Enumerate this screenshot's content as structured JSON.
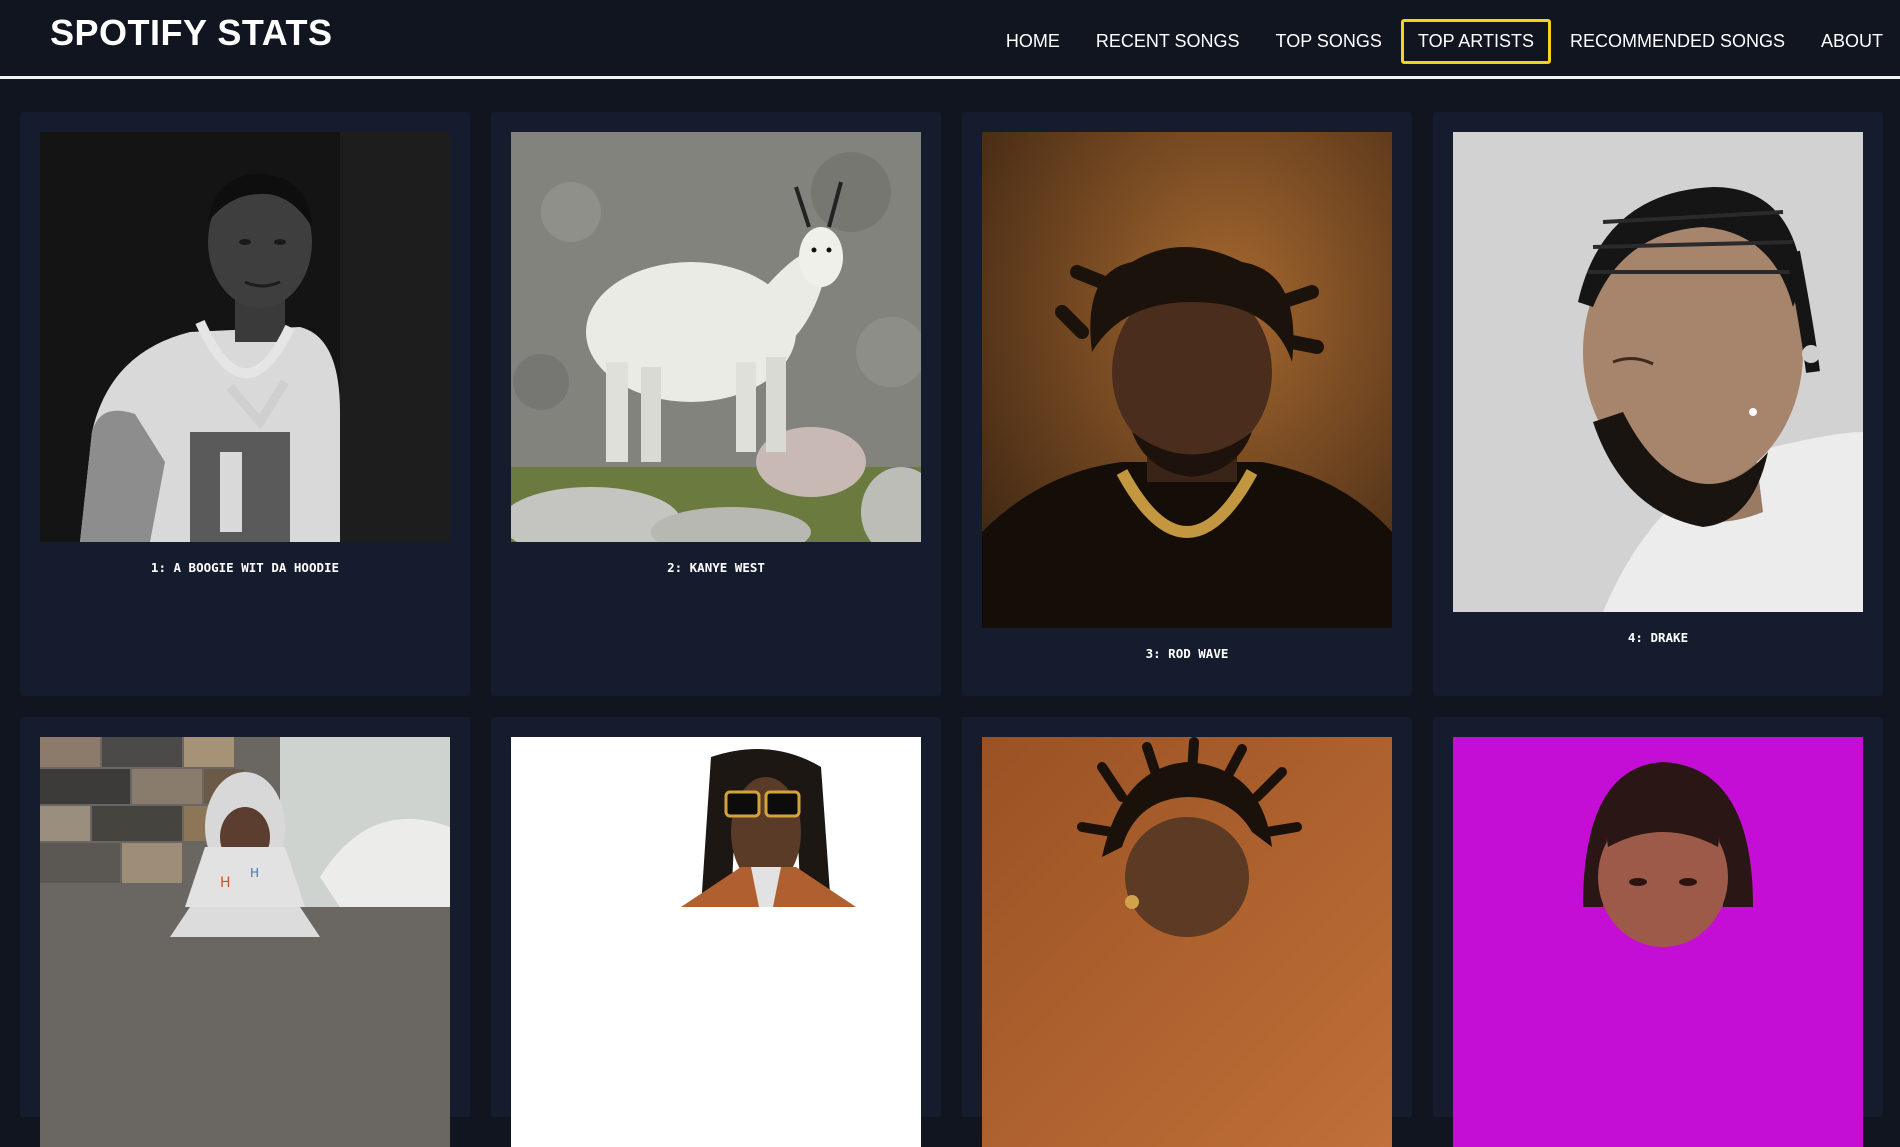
{
  "app": {
    "title": "SPOTIFY STATS"
  },
  "nav": {
    "items": [
      {
        "label": "HOME",
        "active": false
      },
      {
        "label": "RECENT SONGS",
        "active": false
      },
      {
        "label": "TOP SONGS",
        "active": false
      },
      {
        "label": "TOP ARTISTS",
        "active": true
      },
      {
        "label": "RECOMMENDED SONGS",
        "active": false
      },
      {
        "label": "ABOUT",
        "active": false
      }
    ],
    "active_border_color": "#f5d21c"
  },
  "artists": [
    {
      "caption": "1: A BOOGIE WIT DA HOODIE",
      "image": "black-and-white-portrait"
    },
    {
      "caption": "2: KANYE WEST",
      "image": "mountain-goat-photo"
    },
    {
      "caption": "3: ROD WAVE",
      "image": "portrait-brown-background"
    },
    {
      "caption": "4: DRAKE",
      "image": "black-and-white-profile-portrait"
    },
    {
      "caption": "",
      "image": "portrait-stone-wall"
    },
    {
      "caption": "",
      "image": "portrait-sunglasses-white-background"
    },
    {
      "caption": "",
      "image": "portrait-orange-background"
    },
    {
      "caption": "",
      "image": "portrait-magenta-background"
    }
  ],
  "colors": {
    "page_background": "#11151f",
    "card_background": "#141c2d",
    "text": "#ffffff"
  }
}
